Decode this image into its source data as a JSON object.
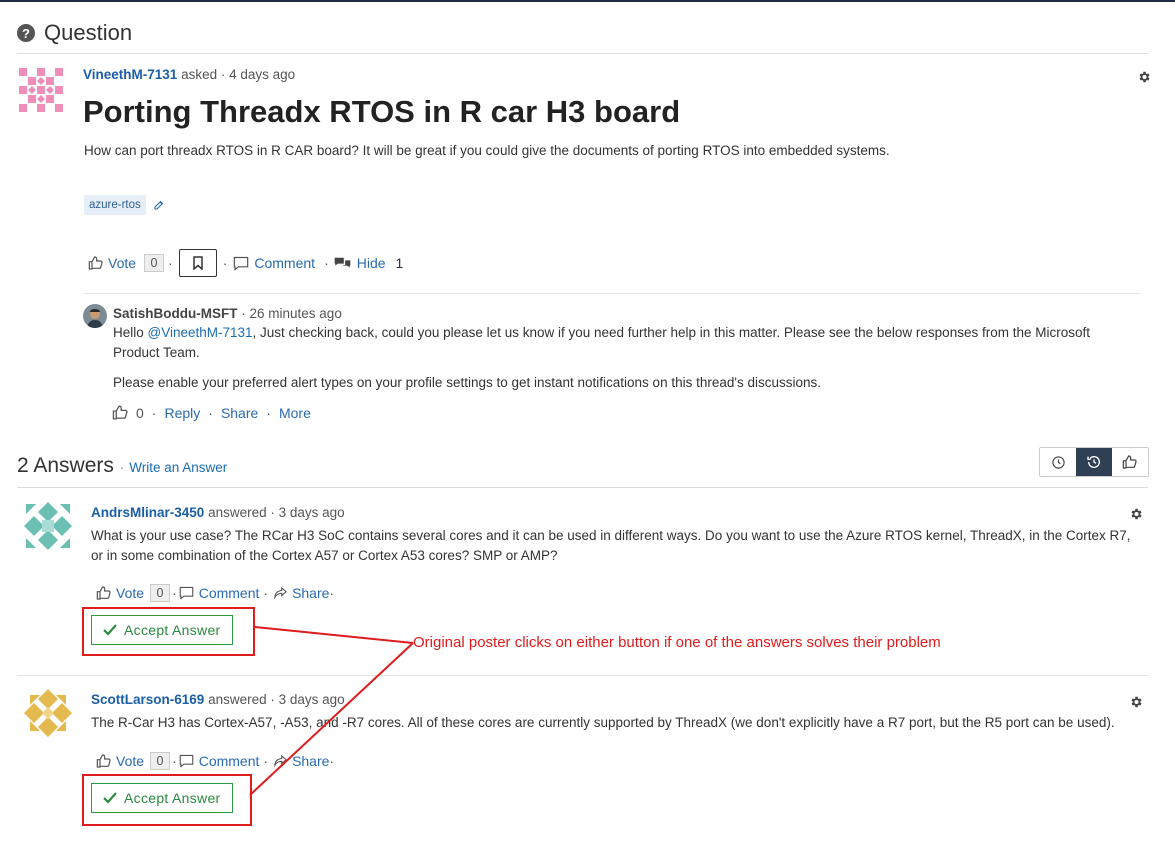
{
  "header": {
    "title": "Question"
  },
  "question": {
    "author": "VineethM-7131",
    "asked_text": "asked · 4 days ago",
    "title": "Porting Threadx RTOS in R car H3 board",
    "body": "How can port threadx RTOS in R CAR board? It will be great if you could give the documents of porting RTOS into embedded systems.",
    "tag": "azure-rtos",
    "vote_label": "Vote",
    "vote_count": "0",
    "comment_label": "Comment",
    "hide_label": "Hide",
    "comments_count": "1"
  },
  "comment": {
    "author": "SatishBoddu-MSFT",
    "time": "· 26 minutes ago",
    "line1_prefix": "Hello ",
    "mention": "@VineethM-7131",
    "line1_rest": ", Just checking back, could you please let us know if you need further help in this matter. Please see the below responses from the Microsoft Product Team.",
    "line2": "Please enable your preferred alert types on your profile settings to get instant notifications on this thread's discussions.",
    "likes": "0",
    "reply_label": "Reply",
    "share_label": "Share",
    "more_label": "More"
  },
  "answers_header": {
    "title": "2 Answers",
    "write_label": "Write an Answer"
  },
  "answers": [
    {
      "author": "AndrsMlinar-3450",
      "meta": "answered · 3 days ago",
      "body": "What is your use case? The RCar H3 SoC contains several cores and it can be used in different ways. Do you want to use the Azure RTOS kernel, ThreadX, in the Cortex R7, or in some combination of the Cortex A57 or Cortex A53 cores? SMP or AMP?",
      "vote_label": "Vote",
      "vote_count": "0",
      "comment_label": "Comment",
      "share_label": "Share",
      "accept_label": "Accept Answer"
    },
    {
      "author": "ScottLarson-6169",
      "meta": "answered · 3 days ago",
      "body": "The R-Car H3 has Cortex-A57, -A53, and -R7 cores. All of these cores are currently supported by ThreadX (we don't explicitly have a R7 port, but the R5 port can be used).",
      "vote_label": "Vote",
      "vote_count": "0",
      "comment_label": "Comment",
      "share_label": "Share",
      "accept_label": "Accept Answer"
    }
  ],
  "annotation": {
    "text": "Original poster clicks on either button if one of the answers solves their problem"
  },
  "colors": {
    "link": "#1a6cb5",
    "accept": "#2e9a45",
    "annotation": "#e01b1b",
    "sort_active": "#2f3f54"
  }
}
